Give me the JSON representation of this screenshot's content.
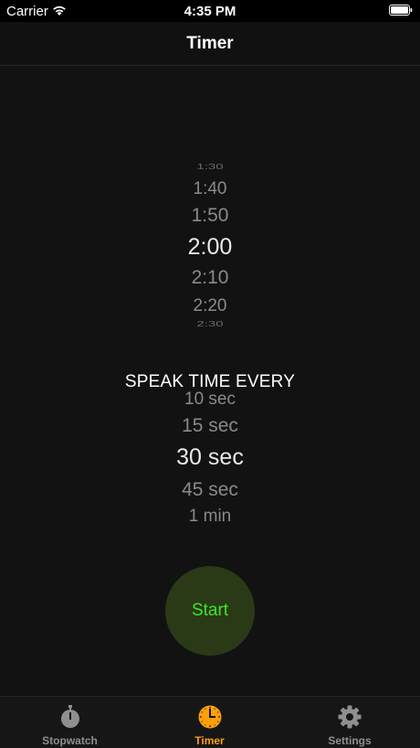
{
  "status_bar": {
    "carrier": "Carrier",
    "time": "4:35 PM"
  },
  "nav": {
    "title": "Timer"
  },
  "duration_picker": {
    "items": [
      "1:30",
      "1:40",
      "1:50",
      "2:00",
      "2:10",
      "2:20",
      "2:30"
    ],
    "selected": "2:00"
  },
  "speak_label": "SPEAK TIME EVERY",
  "interval_picker": {
    "items": [
      "10 sec",
      "15 sec",
      "30 sec",
      "45 sec",
      "1 min"
    ],
    "selected": "30 sec"
  },
  "start_button": {
    "label": "Start"
  },
  "tabs": [
    {
      "label": "Stopwatch",
      "icon": "stopwatch-icon",
      "active": false
    },
    {
      "label": "Timer",
      "icon": "timer-icon",
      "active": true
    },
    {
      "label": "Settings",
      "icon": "gear-icon",
      "active": false
    }
  ],
  "colors": {
    "accent": "#ff9f0a",
    "start_text": "#3ce62a",
    "start_bg": "#2a3a16",
    "inactive_tab": "#8f8f8f"
  }
}
